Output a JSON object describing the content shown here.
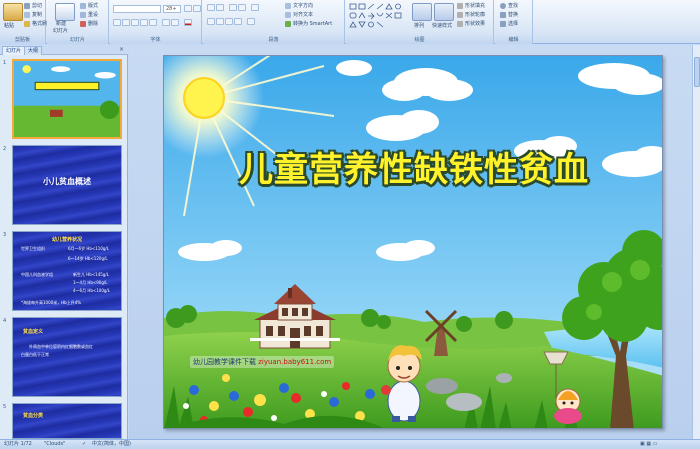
{
  "ribbon": {
    "clipboard": {
      "paste": "粘贴",
      "cut": "剪切",
      "copy": "复制",
      "format_painter": "格式刷",
      "label": "剪贴板"
    },
    "slides": {
      "new_slide": "新建",
      "new_slide2": "幻灯片",
      "layout": "版式",
      "reset": "重设",
      "delete": "删除",
      "label": "幻灯片"
    },
    "font": {
      "font_size": "28+",
      "label": "字体"
    },
    "paragraph": {
      "text_direction": "文字方向",
      "align_text": "对齐文本",
      "smartart": "转换为 SmartArt",
      "label": "段落"
    },
    "drawing": {
      "arrange": "排列",
      "quick_styles": "快速样式",
      "shape_fill": "形状填充",
      "shape_outline": "形状轮廓",
      "shape_effects": "形状效果",
      "label": "绘图"
    },
    "editing": {
      "find": "查找",
      "replace": "替换",
      "select": "选择",
      "label": "编辑"
    }
  },
  "panel": {
    "tab_slides": "幻灯片",
    "tab_outline": "大纲",
    "close": "×",
    "slide_numbers": [
      "1",
      "2",
      "3",
      "4",
      "5"
    ],
    "slide2_title": "小儿贫血概述",
    "slide3_title": "幼儿营养状况",
    "slide3_lines": [
      "世界卫生组织",
      "6月～6岁 Hb<110g/L",
      "6～14岁 Hb<120g/L",
      "中国儿科血液学组",
      "新生儿 Hb<145g/L",
      "1～4月 Hb<90g/L",
      "4～6月 Hb<100g/L",
      "*海拔每升高1000米，Hb上升4%"
    ],
    "slide4_title": "贫血定义",
    "slide4_lines": [
      "外周血中单位容积内红细胞数或血红",
      "白蛋白低于正常"
    ],
    "slide5_title": "贫血分类"
  },
  "slide": {
    "title": "儿童营养性缺铁性贫血",
    "credit_prefix": "幼儿园教学课件下载",
    "credit_url": "ziyuan.baby611.com"
  },
  "status": {
    "slide_count": "幻灯片 1/72",
    "theme": "\"Clouds\"",
    "language": "中文(简体，中国)"
  },
  "colors": {
    "ribbon_bg": "#dbe7f6",
    "title_yellow": "#fff22a",
    "sky": "#4db3ec",
    "grass": "#5fb52c",
    "thumb_dark": "#2639b8",
    "selection": "#f2a93b"
  }
}
